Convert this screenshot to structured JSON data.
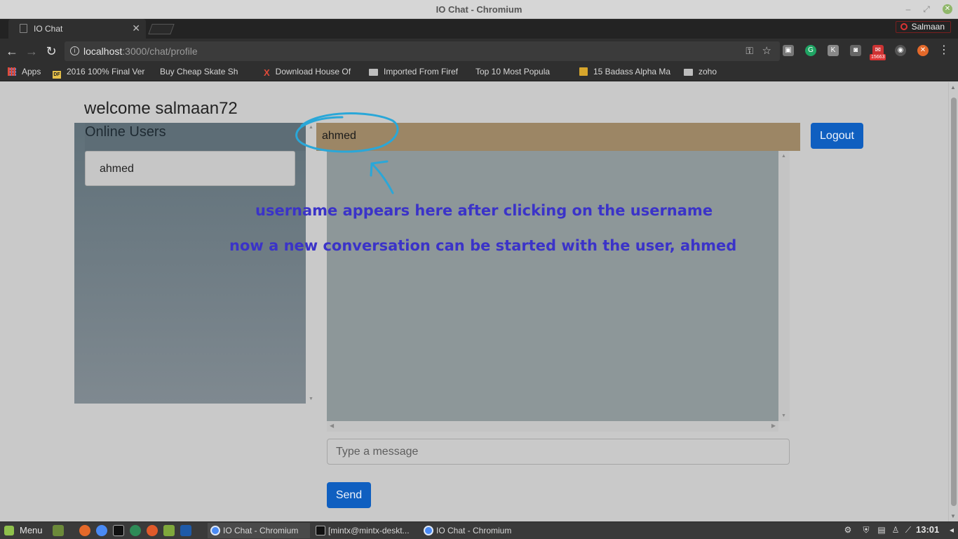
{
  "window": {
    "title": "IO Chat - Chromium",
    "minimize_glyph": "‒",
    "restore_glyph": "⤢",
    "close_glyph": "✕"
  },
  "browser": {
    "tab": {
      "label": "IO Chat",
      "close_glyph": "✕"
    },
    "profile_name": "Salmaan",
    "url_host": "localhost",
    "url_path": ":3000/chat/profile",
    "extension_badge": "15663",
    "bookmarks": [
      {
        "label": "Apps",
        "icon": "apps-grid-icon"
      },
      {
        "label": "2016 100% Final Ver",
        "icon": "df-favicon-icon"
      },
      {
        "label": "Buy Cheap Skate Sh",
        "icon": "page-icon"
      },
      {
        "label": "Download House Of",
        "icon": "x-favicon-icon"
      },
      {
        "label": "Imported From Firef",
        "icon": "folder-icon"
      },
      {
        "label": "Top 10 Most Popula",
        "icon": "page-icon"
      },
      {
        "label": "15 Badass Alpha Ma",
        "icon": "bookmark-favicon-icon"
      },
      {
        "label": "zoho",
        "icon": "folder-icon"
      }
    ]
  },
  "app": {
    "welcome": "welcome salmaan72",
    "online_users_heading": "Online Users",
    "online_users": [
      "ahmed"
    ],
    "chat_header_user": "ahmed",
    "logout_label": "Logout",
    "message_placeholder": "Type a message",
    "send_label": "Send"
  },
  "annotations": {
    "line1": "username appears here after clicking on the username",
    "line2": "now a new conversation can be started with the user, ahmed",
    "circle_color": "#2aa7d8",
    "text_color": "#3b33c8"
  },
  "taskbar": {
    "menu_label": "Menu",
    "tasks": [
      {
        "label": "IO Chat - Chromium",
        "active": true
      },
      {
        "label": "[mintx@mintx-deskt...",
        "active": false
      },
      {
        "label": "IO Chat - Chromium",
        "active": false
      }
    ],
    "clock": "13:01"
  },
  "colors": {
    "chat_header": "#9c8665",
    "button_primary": "#0f5fc0",
    "users_panel": "#5f7079",
    "messages_area": "#8d9799"
  }
}
